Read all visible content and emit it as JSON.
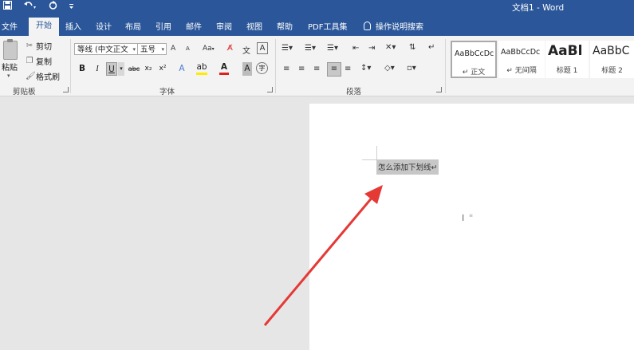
{
  "window": {
    "title": "文档1 - Word"
  },
  "qat": {
    "save_icon": "save-icon",
    "undo_icon": "undo-icon",
    "redo_icon": "redo-icon"
  },
  "tabs": [
    {
      "label": "文件"
    },
    {
      "label": "开始"
    },
    {
      "label": "插入"
    },
    {
      "label": "设计"
    },
    {
      "label": "布局"
    },
    {
      "label": "引用"
    },
    {
      "label": "邮件"
    },
    {
      "label": "审阅"
    },
    {
      "label": "视图"
    },
    {
      "label": "帮助"
    },
    {
      "label": "PDF工具集"
    }
  ],
  "active_tab": "开始",
  "tell_me": {
    "label": "操作说明搜索"
  },
  "clipboard": {
    "paste": "粘贴",
    "cut": "剪切",
    "copy": "复制",
    "format_painter": "格式刷",
    "group": "剪贴板"
  },
  "font": {
    "name": "等线 (中文正文",
    "size": "五号",
    "grow": "A",
    "shrink": "A",
    "case": "Aa",
    "bold": "B",
    "italic": "I",
    "underline": "U",
    "strikethrough": "abc",
    "subscript": "x₂",
    "superscript": "x²",
    "font_color": "A",
    "char_shading": "A",
    "group": "字体"
  },
  "paragraph": {
    "group": "段落"
  },
  "styles": [
    {
      "sample": "AaBbCcDc",
      "name": "↵ 正文"
    },
    {
      "sample": "AaBbCcDc",
      "name": "↵ 无间隔"
    },
    {
      "sample": "AaBl",
      "name": "标题 1"
    },
    {
      "sample": "AaBbC",
      "name": "标题 2"
    }
  ],
  "document": {
    "selected_text": "怎么添加下划线↵"
  },
  "colors": {
    "accent": "#2b579a",
    "arrow": "#e53935",
    "ribbon": "#f3f3f3",
    "canvas": "#e6e6e6"
  }
}
